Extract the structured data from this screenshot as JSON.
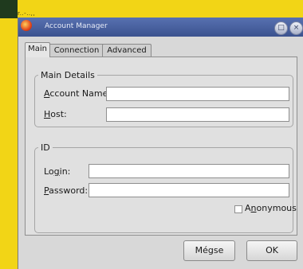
{
  "background": {
    "accent": "#f2d516",
    "corner_color": "#1f3a1e",
    "partial_text": "r..-..,,"
  },
  "window": {
    "title": "Account Manager",
    "titlebar_buttons": [
      {
        "icon": "restore-icon",
        "glyph": "□"
      },
      {
        "icon": "close-icon",
        "glyph": "×"
      }
    ]
  },
  "tabs": [
    {
      "label": "Main",
      "active": true
    },
    {
      "label": "Connection",
      "active": false
    },
    {
      "label": "Advanced",
      "active": false
    }
  ],
  "main_details": {
    "legend": "Main Details",
    "account_name": {
      "mnemonic": "A",
      "label_rest": "ccount Name:",
      "value": ""
    },
    "host": {
      "mnemonic": "H",
      "label_rest": "ost:",
      "value": ""
    }
  },
  "id_group": {
    "legend": "ID",
    "login": {
      "label_start": "Lo",
      "mnemonic": "g",
      "label_end": "in:",
      "value": ""
    },
    "password": {
      "mnemonic": "P",
      "label_rest": "assword:",
      "value": ""
    },
    "anonymous": {
      "label_start": "A",
      "mnemonic": "n",
      "label_end": "onymous",
      "checked": false
    }
  },
  "buttons": {
    "cancel": "Mégse",
    "ok": "OK"
  }
}
